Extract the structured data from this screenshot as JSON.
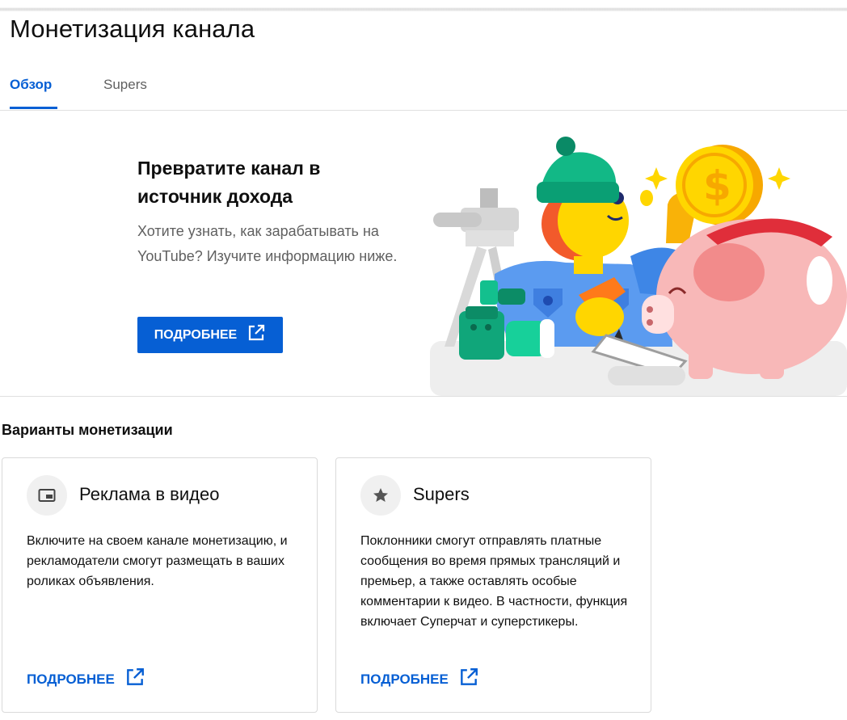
{
  "page": {
    "title": "Монетизация канала"
  },
  "tabs": [
    {
      "label": "Обзор",
      "active": true
    },
    {
      "label": "Supers",
      "active": false
    }
  ],
  "hero": {
    "title": "Превратите канал в источник дохода",
    "description": "Хотите узнать, как зарабатывать на YouTube? Изучите информацию ниже.",
    "button_label": "ПОДРОБНЕЕ",
    "button_icon": "open-in-new-icon"
  },
  "section": {
    "title": "Варианты монетизации"
  },
  "cards": [
    {
      "icon": "video-ad-icon",
      "title": "Реклама в видео",
      "description": "Включите на своем канале монетизацию, и рекламодатели смогут размещать в ваших роликах объявления.",
      "link_label": "ПОДРОБНЕЕ",
      "link_icon": "open-in-new-icon"
    },
    {
      "icon": "star-icon",
      "title": "Supers",
      "description": "Поклонники смогут отправлять платные сообщения во время прямых трансляций и премьер, а также оставлять особые комментарии к видео. В частности, функция включает Суперчат и суперстикеры.",
      "link_label": "ПОДРОБНЕЕ",
      "link_icon": "open-in-new-icon"
    }
  ],
  "colors": {
    "accent": "#065fd4",
    "secondary_text": "#606060",
    "border": "#e0e0e0"
  }
}
